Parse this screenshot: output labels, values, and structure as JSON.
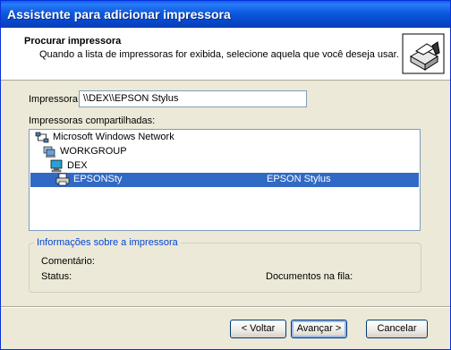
{
  "window": {
    "title": "Assistente para adicionar impressora"
  },
  "header": {
    "title": "Procurar impressora",
    "subtitle": "Quando a lista de impressoras for exibida, selecione aquela que você deseja usar."
  },
  "printer_field": {
    "label": "Impressora:",
    "value": "\\\\DEX\\\\EPSON Stylus"
  },
  "shared_list": {
    "label": "Impressoras compartilhadas:",
    "items": [
      {
        "label": "Microsoft Windows Network",
        "icon": "network-icon"
      },
      {
        "label": "WORKGROUP",
        "icon": "workgroup-icon"
      },
      {
        "label": "DEX",
        "icon": "computer-icon"
      },
      {
        "label": "EPSONSty",
        "comment": "EPSON Stylus",
        "icon": "printer-icon",
        "selected": true
      }
    ]
  },
  "info": {
    "legend": "Informações sobre a impressora",
    "comment_label": "Comentário:",
    "status_label": "Status:",
    "queue_label": "Documentos na fila:"
  },
  "buttons": {
    "back": "< Voltar",
    "next": "Avançar >",
    "cancel": "Cancelar"
  },
  "colors": {
    "title_bar": "#0a5ef0",
    "selection": "#316ac5",
    "legend": "#0046d5",
    "face": "#ece9d8"
  }
}
